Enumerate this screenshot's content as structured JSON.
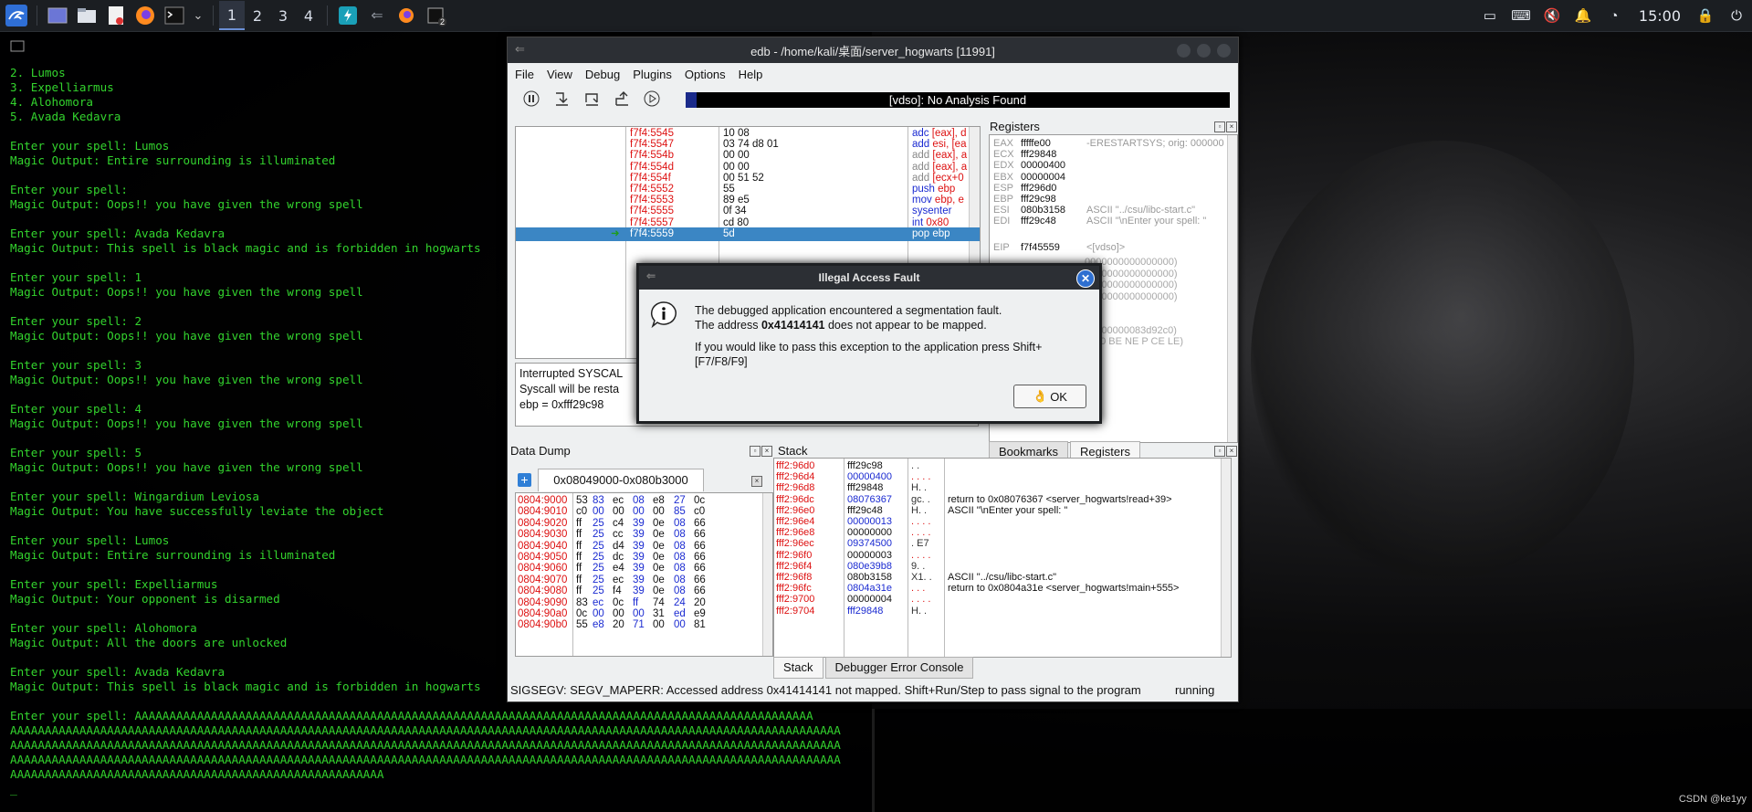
{
  "taskbar": {
    "workspaces": [
      "1",
      "2",
      "3",
      "4"
    ],
    "active_workspace": "1",
    "badge": "2",
    "clock": "15:00"
  },
  "terminal": {
    "lines": [
      "2. Lumos",
      "3. Expelliarmus",
      "4. Alohomora",
      "5. Avada Kedavra",
      "",
      "Enter your spell: Lumos",
      "Magic Output: Entire surrounding is illuminated",
      "",
      "Enter your spell:",
      "Magic Output: Oops!! you have given the wrong spell",
      "",
      "Enter your spell: Avada Kedavra",
      "Magic Output: This spell is black magic and is forbidden in hogwarts",
      "",
      "Enter your spell: 1",
      "Magic Output: Oops!! you have given the wrong spell",
      "",
      "Enter your spell: 2",
      "Magic Output: Oops!! you have given the wrong spell",
      "",
      "Enter your spell: 3",
      "Magic Output: Oops!! you have given the wrong spell",
      "",
      "Enter your spell: 4",
      "Magic Output: Oops!! you have given the wrong spell",
      "",
      "Enter your spell: 5",
      "Magic Output: Oops!! you have given the wrong spell",
      "",
      "Enter your spell: Wingardium Leviosa",
      "Magic Output: You have successfully leviate the object",
      "",
      "Enter your spell: Lumos",
      "Magic Output: Entire surrounding is illuminated",
      "",
      "Enter your spell: Expelliarmus",
      "Magic Output: Your opponent is disarmed",
      "",
      "Enter your spell: Alohomora",
      "Magic Output: All the doors are unlocked",
      "",
      "Enter your spell: Avada Kedavra",
      "Magic Output: This spell is black magic and is forbidden in hogwarts",
      "",
      "Enter your spell: AAAAAAAAAAAAAAAAAAAAAAAAAAAAAAAAAAAAAAAAAAAAAAAAAAAAAAAAAAAAAAAAAAAAAAAAAAAAAAAAAAAAAAAAAAAAAAAAAA",
      "AAAAAAAAAAAAAAAAAAAAAAAAAAAAAAAAAAAAAAAAAAAAAAAAAAAAAAAAAAAAAAAAAAAAAAAAAAAAAAAAAAAAAAAAAAAAAAAAAAAAAAAAAAAAAAAAAAAAAAAA",
      "AAAAAAAAAAAAAAAAAAAAAAAAAAAAAAAAAAAAAAAAAAAAAAAAAAAAAAAAAAAAAAAAAAAAAAAAAAAAAAAAAAAAAAAAAAAAAAAAAAAAAAAAAAAAAAAAAAAAAAAA",
      "AAAAAAAAAAAAAAAAAAAAAAAAAAAAAAAAAAAAAAAAAAAAAAAAAAAAAAAAAAAAAAAAAAAAAAAAAAAAAAAAAAAAAAAAAAAAAAAAAAAAAAAAAAAAAAAAAAAAAAAA",
      "AAAAAAAAAAAAAAAAAAAAAAAAAAAAAAAAAAAAAAAAAAAAAAAAAAAAAA"
    ],
    "cursor": "_"
  },
  "edb": {
    "title": "edb - /home/kali/桌面/server_hogwarts [11991]",
    "menu": [
      "File",
      "View",
      "Debug",
      "Plugins",
      "Options",
      "Help"
    ],
    "analysis_status": "[vdso]: No Analysis Found",
    "disasm": [
      {
        "addr": "f7f4:5545",
        "bytes": "10 08",
        "ins": "adc [eax], d"
      },
      {
        "addr": "f7f4:5547",
        "bytes": "03 74 d8 01",
        "ins": "add esi, [ea"
      },
      {
        "addr": "f7f4:554b",
        "bytes": "00 00",
        "ins": "add [eax], a"
      },
      {
        "addr": "f7f4:554d",
        "bytes": "00 00",
        "ins": "add [eax], a"
      },
      {
        "addr": "f7f4:554f",
        "bytes": "00 51 52",
        "ins": "add [ecx+0"
      },
      {
        "addr": "f7f4:5552",
        "bytes": "55",
        "ins": "push ebp"
      },
      {
        "addr": "f7f4:5553",
        "bytes": "89 e5",
        "ins": "mov ebp, e"
      },
      {
        "addr": "f7f4:5555",
        "bytes": "0f 34",
        "ins": "sysenter"
      },
      {
        "addr": "f7f4:5557",
        "bytes": "cd 80",
        "ins": "int 0x80"
      },
      {
        "addr": "f7f4:5559",
        "bytes": "5d",
        "ins": "pop ebp"
      }
    ],
    "info": [
      "Interrupted SYSCAL",
      "Syscall will be resta",
      "ebp = 0xfff29c98"
    ],
    "registers_title": "Registers",
    "registers": [
      {
        "name": "EAX",
        "value": "fffffe00",
        "comment": "-ERESTARTSYS; orig: 000000"
      },
      {
        "name": "ECX",
        "value": "fff29848",
        "comment": ""
      },
      {
        "name": "EDX",
        "value": "00000400",
        "comment": ""
      },
      {
        "name": "EBX",
        "value": "00000004",
        "comment": ""
      },
      {
        "name": "ESP",
        "value": "fff296d0",
        "comment": ""
      },
      {
        "name": "EBP",
        "value": "fff29c98",
        "comment": ""
      },
      {
        "name": "ESI",
        "value": "080b3158",
        "comment": "ASCII \"../csu/libc-start.c\""
      },
      {
        "name": "EDI",
        "value": "fff29c48",
        "comment": "ASCII \"\\nEnter your spell: \""
      }
    ],
    "eip": {
      "name": "EIP",
      "value": "f7f45559",
      "comment": "<[vdso]>"
    },
    "reg_extra": [
      "0000000000000000)",
      "0000000000000000)",
      "0000000000000000)",
      "0000000000000000)",
      "0",
      "00000000083d92c0)",
      "AF 0 BE NE P CE LE)"
    ],
    "reg_tabs": [
      "Bookmarks",
      "Registers"
    ],
    "data_dump_title": "Data Dump",
    "data_dump_tab": "0x08049000-0x080b3000",
    "data_dump": [
      {
        "addr": "0804:9000",
        "bytes": [
          "53",
          "83",
          "ec",
          "08",
          "e8",
          "27",
          "0c"
        ]
      },
      {
        "addr": "0804:9010",
        "bytes": [
          "c0",
          "00",
          "00",
          "00",
          "00",
          "85",
          "c0"
        ]
      },
      {
        "addr": "0804:9020",
        "bytes": [
          "ff",
          "25",
          "c4",
          "39",
          "0e",
          "08",
          "66"
        ]
      },
      {
        "addr": "0804:9030",
        "bytes": [
          "ff",
          "25",
          "cc",
          "39",
          "0e",
          "08",
          "66"
        ]
      },
      {
        "addr": "0804:9040",
        "bytes": [
          "ff",
          "25",
          "d4",
          "39",
          "0e",
          "08",
          "66"
        ]
      },
      {
        "addr": "0804:9050",
        "bytes": [
          "ff",
          "25",
          "dc",
          "39",
          "0e",
          "08",
          "66"
        ]
      },
      {
        "addr": "0804:9060",
        "bytes": [
          "ff",
          "25",
          "e4",
          "39",
          "0e",
          "08",
          "66"
        ]
      },
      {
        "addr": "0804:9070",
        "bytes": [
          "ff",
          "25",
          "ec",
          "39",
          "0e",
          "08",
          "66"
        ]
      },
      {
        "addr": "0804:9080",
        "bytes": [
          "ff",
          "25",
          "f4",
          "39",
          "0e",
          "08",
          "66"
        ]
      },
      {
        "addr": "0804:9090",
        "bytes": [
          "83",
          "ec",
          "0c",
          "ff",
          "74",
          "24",
          "20"
        ]
      },
      {
        "addr": "0804:90a0",
        "bytes": [
          "0c",
          "00",
          "00",
          "00",
          "31",
          "ed",
          "e9"
        ]
      },
      {
        "addr": "0804:90b0",
        "bytes": [
          "55",
          "e8",
          "20",
          "71",
          "00",
          "00",
          "81"
        ]
      }
    ],
    "stack_title": "Stack",
    "stack": [
      {
        "addr": "fff2:96d0",
        "value": "fff29c98",
        "ascii": ". .",
        "comment": ""
      },
      {
        "addr": "fff2:96d4",
        "value": "00000400",
        "ascii": ". . . .",
        "comment": ""
      },
      {
        "addr": "fff2:96d8",
        "value": "fff29848",
        "ascii": "H. .",
        "comment": ""
      },
      {
        "addr": "fff2:96dc",
        "value": "08076367",
        "ascii": "gc. .",
        "comment": "return to 0x08076367 <server_hogwarts!read+39>"
      },
      {
        "addr": "fff2:96e0",
        "value": "fff29c48",
        "ascii": "H. .",
        "comment": "ASCII \"\\nEnter your spell: \""
      },
      {
        "addr": "fff2:96e4",
        "value": "00000013",
        "ascii": ". . . .",
        "comment": ""
      },
      {
        "addr": "fff2:96e8",
        "value": "00000000",
        "ascii": ". . . .",
        "comment": ""
      },
      {
        "addr": "fff2:96ec",
        "value": "09374500",
        "ascii": ". E7",
        "comment": ""
      },
      {
        "addr": "fff2:96f0",
        "value": "00000003",
        "ascii": ". . . .",
        "comment": ""
      },
      {
        "addr": "fff2:96f4",
        "value": "080e39b8",
        "ascii": "9. .",
        "comment": ""
      },
      {
        "addr": "fff2:96f8",
        "value": "080b3158",
        "ascii": "X1. .",
        "comment": "ASCII \"../csu/libc-start.c\""
      },
      {
        "addr": "fff2:96fc",
        "value": "0804a31e",
        "ascii": ". . .",
        "comment": "return to 0x0804a31e <server_hogwarts!main+555>"
      },
      {
        "addr": "fff2:9700",
        "value": "00000004",
        "ascii": ". . . .",
        "comment": ""
      },
      {
        "addr": "fff2:9704",
        "value": "fff29848",
        "ascii": "H. .",
        "comment": ""
      }
    ],
    "stack_tabs": [
      "Stack",
      "Debugger Error Console"
    ],
    "status": "SIGSEGV: SEGV_MAPERR: Accessed address 0x41414141 not mapped. Shift+Run/Step to pass signal to the program",
    "run_state": "running"
  },
  "modal": {
    "title": "Illegal Access Fault",
    "line1": "The debugged application encountered a segmentation fault.",
    "line2_pre": "The address ",
    "line2_addr": "0x41414141",
    "line2_post": " does not appear to be mapped.",
    "line3": "If you would like to pass this exception to the application press Shift+[F7/F8/F9]",
    "ok": "OK"
  },
  "watermark": "CSDN @ke1yy",
  "colors": {
    "terminal_green": "#33d42e",
    "selection": "#3b86c4",
    "address_red": "#d11",
    "value_blue": "#1a2ad1"
  }
}
